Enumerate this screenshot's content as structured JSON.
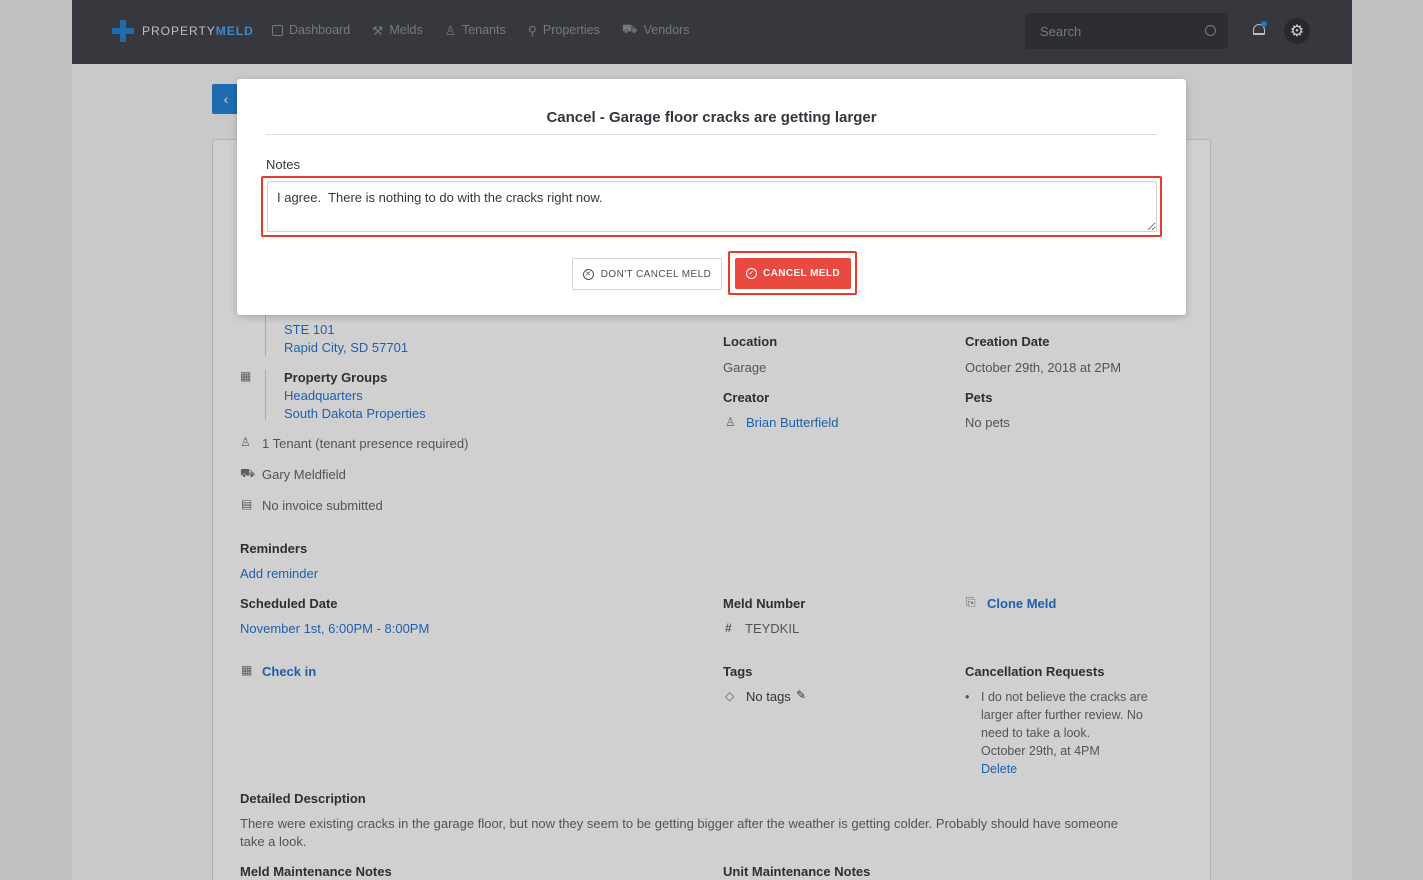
{
  "header": {
    "logo_text_a": "PROPERTY",
    "logo_text_b": "MELD",
    "nav": [
      {
        "label": "Dashboard",
        "icon": "dashboard-icon"
      },
      {
        "label": "Melds",
        "icon": "tools-icon"
      },
      {
        "label": "Tenants",
        "icon": "user-icon"
      },
      {
        "label": "Properties",
        "icon": "pin-icon"
      },
      {
        "label": "Vendors",
        "icon": "truck-icon"
      }
    ],
    "search_placeholder": "Search"
  },
  "details": {
    "address_line1": "STE 101",
    "address_line2": "Rapid City, SD 57701",
    "property_groups_label": "Property Groups",
    "property_groups": [
      "Headquarters",
      "South Dakota Properties"
    ],
    "tenant_text": "1 Tenant (tenant presence required)",
    "vendor_text": "Gary Meldfield",
    "invoice_text": "No invoice submitted",
    "reminders_label": "Reminders",
    "add_reminder": "Add reminder",
    "scheduled_label": "Scheduled Date",
    "scheduled_value": "November 1st, 6:00PM - 8:00PM",
    "check_in": "Check in",
    "detailed_label": "Detailed Description",
    "detailed_value_1": "There were existing cracks in the garage floor, but now they seem to be getting bigger after the weather is getting colder.  Probably should have someone",
    "detailed_value_2": "take a look.",
    "meld_notes_label": "Meld Maintenance Notes",
    "unit_notes_label": "Unit Maintenance Notes",
    "location_label": "Location",
    "location_value": "Garage",
    "creator_label": "Creator",
    "creator_value": "Brian Butterfield",
    "creation_label": "Creation Date",
    "creation_value": "October 29th, 2018 at 2PM",
    "pets_label": "Pets",
    "pets_value": "No pets",
    "meld_number_label": "Meld Number",
    "meld_number_value": "TEYDKIL",
    "clone_meld": "Clone Meld",
    "tags_label": "Tags",
    "tags_value": "No tags",
    "cancellation_label": "Cancellation Requests",
    "cancel_req_1": "I do not believe the cracks are",
    "cancel_req_2": "larger after further review. No",
    "cancel_req_3": "need to take a look.",
    "cancel_req_date": "October 29th, at 4PM",
    "cancel_req_delete": "Delete"
  },
  "modal": {
    "title": "Cancel - Garage floor cracks are getting larger",
    "notes_label": "Notes",
    "notes_value": "I agree.  There is nothing to do with the cracks right now.",
    "dont_cancel": "DON'T CANCEL MELD",
    "cancel": "CANCEL MELD"
  },
  "colors": {
    "accent": "#1d7fd8",
    "danger": "#e84a40",
    "highlight": "#e8392c"
  }
}
